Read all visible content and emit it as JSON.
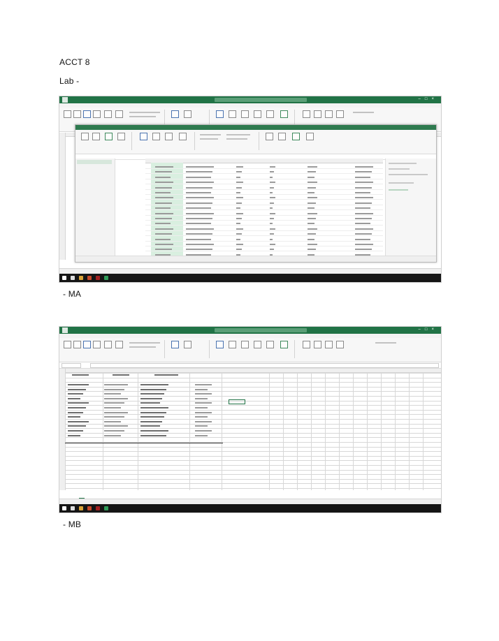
{
  "header": {
    "course": "ACCT   8",
    "lab": "Lab   -"
  },
  "captions": {
    "first": "-  MA",
    "second": "-  MB"
  },
  "colors": {
    "excel_green": "#217346",
    "taskbar": "#151515",
    "query_highlight": "#d9efe0"
  },
  "icons": {
    "excel_logo": "excel-logo-icon",
    "window_controls": "window-controls-icon"
  }
}
